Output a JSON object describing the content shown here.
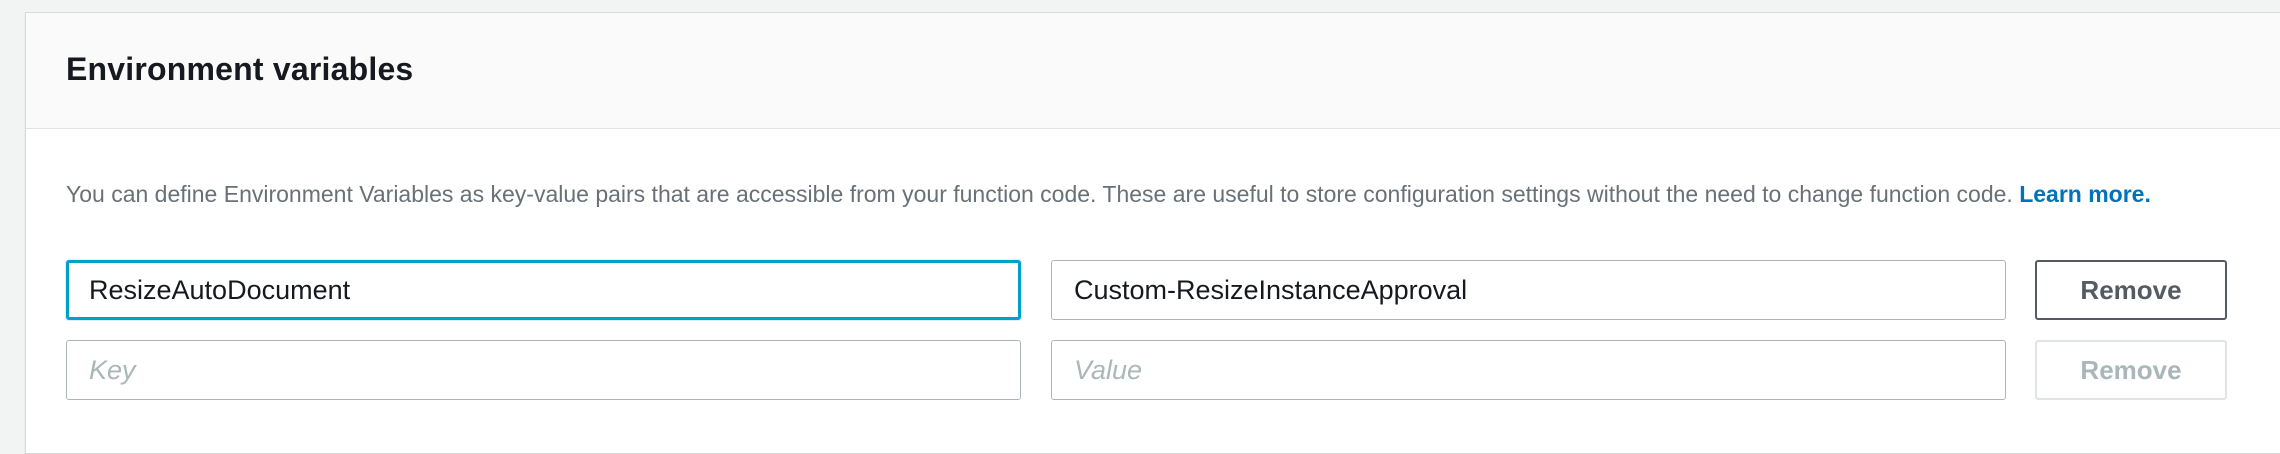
{
  "panel": {
    "title": "Environment variables",
    "description": "You can define Environment Variables as key-value pairs that are accessible from your function code. These are useful to store configuration settings without the need to change function code.",
    "learn_more_label": "Learn more."
  },
  "variables": [
    {
      "key": "ResizeAutoDocument",
      "value": "Custom-ResizeInstanceApproval",
      "key_placeholder": "Key",
      "value_placeholder": "Value",
      "remove_label": "Remove",
      "remove_enabled": true
    },
    {
      "key": "",
      "value": "",
      "key_placeholder": "Key",
      "value_placeholder": "Value",
      "remove_label": "Remove",
      "remove_enabled": false
    }
  ],
  "colors": {
    "focus_border": "#00a1c9",
    "link": "#0073bb",
    "muted_text": "#687078"
  }
}
